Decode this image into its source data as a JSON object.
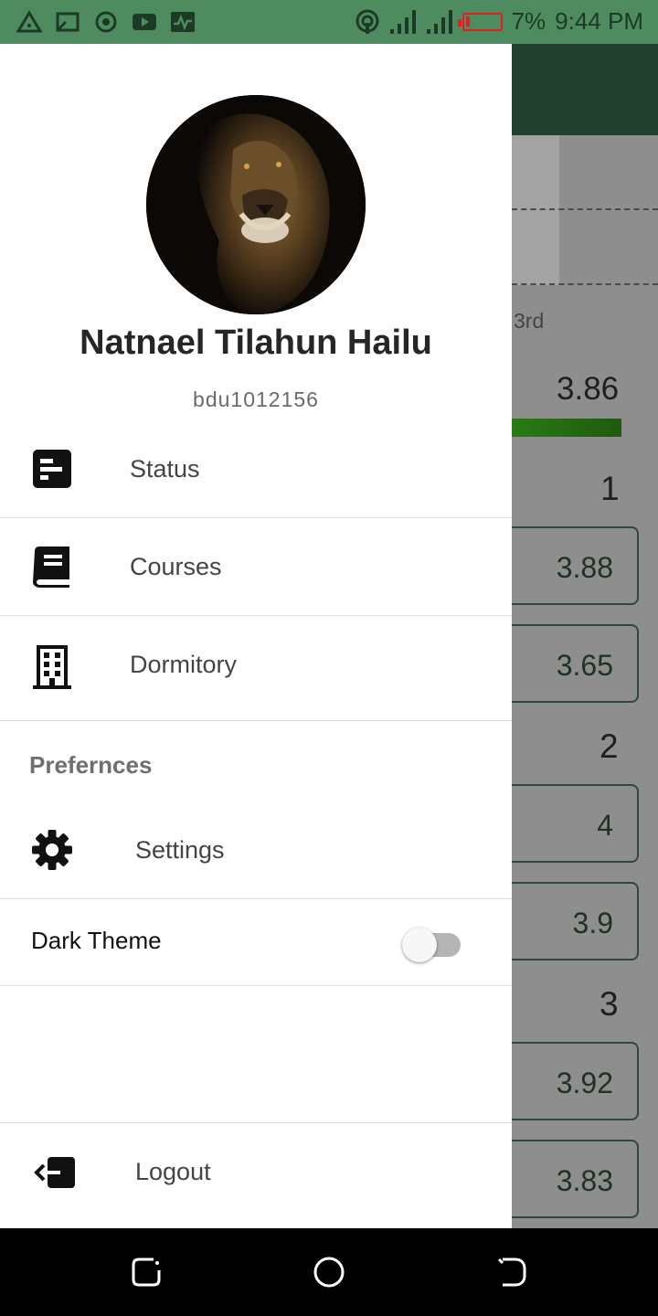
{
  "status_bar": {
    "left_icons": [
      "warning-triangle-icon",
      "cast-icon",
      "record-icon",
      "youtube-icon",
      "activity-icon"
    ],
    "right_icons": [
      "hotspot-icon",
      "signal-icon",
      "signal-icon-2",
      "battery-low-icon"
    ],
    "battery_text": "7%",
    "time": "9:44 PM"
  },
  "background": {
    "rank_label": "3rd",
    "gpa": "3.86",
    "years": [
      {
        "label": "1",
        "semesters": [
          "3.88",
          "3.65"
        ]
      },
      {
        "label": "2",
        "semesters": [
          "4",
          "3.9"
        ]
      },
      {
        "label": "3",
        "semesters": [
          "3.92",
          "3.83"
        ]
      }
    ]
  },
  "drawer": {
    "profile": {
      "name": "Natnael Tilahun Hailu",
      "student_id": "bdu1012156"
    },
    "nav_items": [
      {
        "label": "Status",
        "icon": "status-icon"
      },
      {
        "label": "Courses",
        "icon": "book-icon"
      },
      {
        "label": "Dormitory",
        "icon": "building-icon"
      }
    ],
    "preferences": {
      "title": "Prefernces",
      "settings_label": "Settings",
      "dark_theme_label": "Dark Theme",
      "dark_theme_on": false
    },
    "logout_label": "Logout"
  },
  "colors": {
    "status_bar": "#4e8c60",
    "app_bar": "#233f2d",
    "accent_progress": "#2a7a15",
    "battery": "#e02020"
  },
  "nav_bar": [
    "recents-button",
    "home-button",
    "back-button"
  ]
}
